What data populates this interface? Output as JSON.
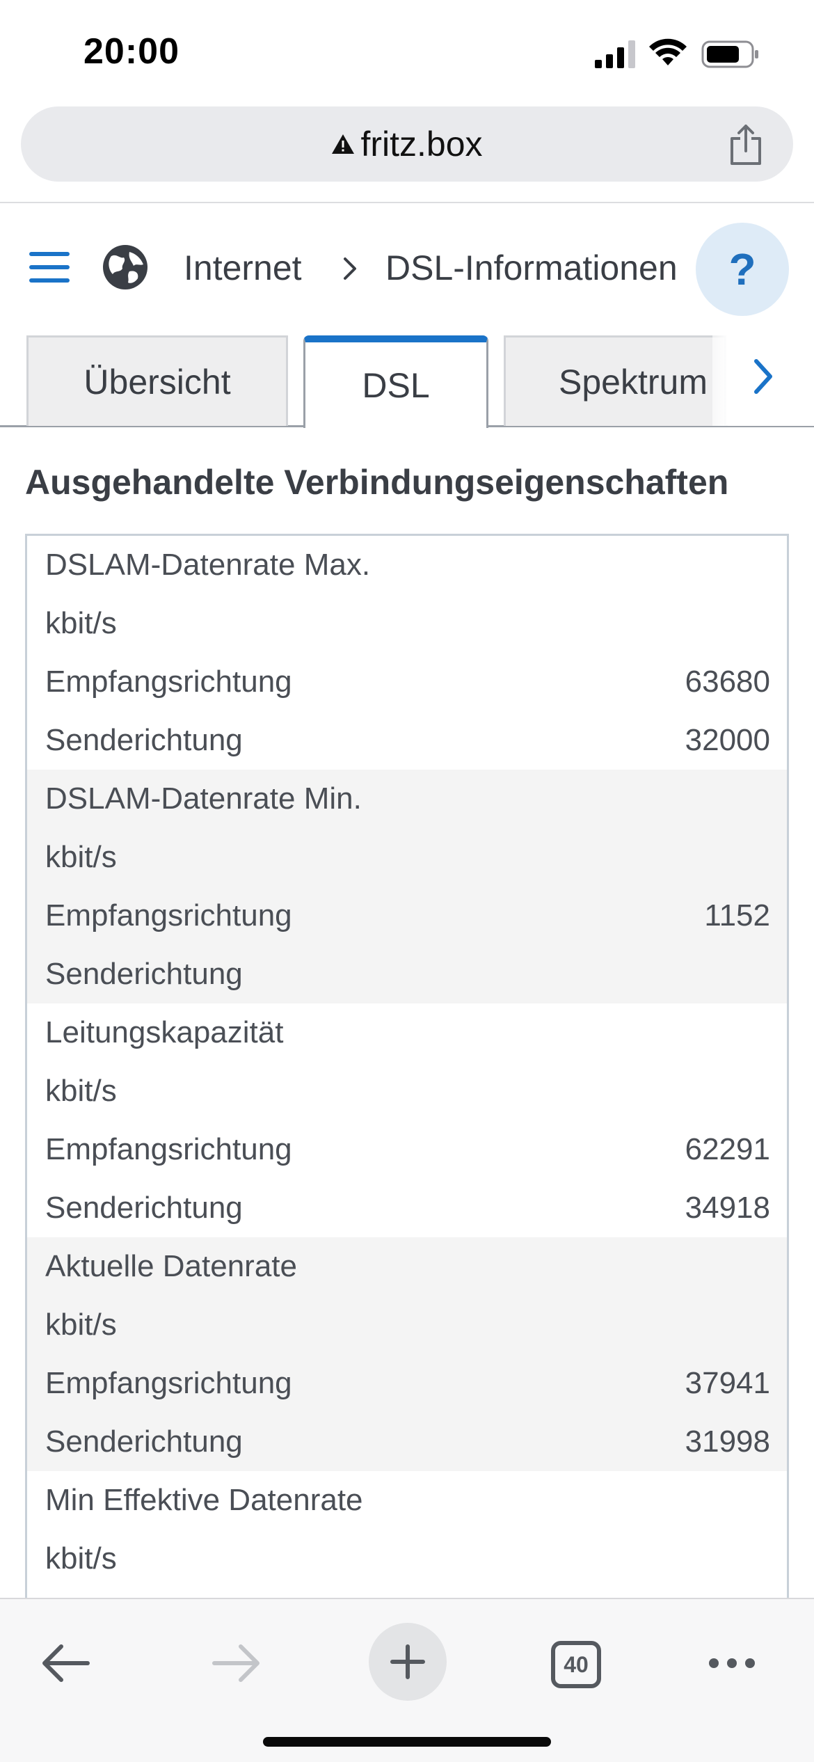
{
  "status_bar": {
    "time": "20:00",
    "icons": [
      "cellular-signal-icon",
      "wifi-icon",
      "battery-icon"
    ]
  },
  "browser": {
    "url": "fritz.box",
    "security_icon": "warning-icon",
    "share_icon": "share-icon",
    "open_tabs_count": "40"
  },
  "breadcrumb": {
    "menu_icon": "hamburger-menu-icon",
    "globe_icon": "globe-icon",
    "items": [
      "Internet",
      "DSL-Informationen"
    ],
    "help_label": "?"
  },
  "tabs": [
    {
      "label": "Übersicht",
      "active": false
    },
    {
      "label": "DSL",
      "active": true
    },
    {
      "label": "Spektrum",
      "active": false
    }
  ],
  "section": {
    "title": "Ausgehandelte Verbindungseigenschaften"
  },
  "table": {
    "groups": [
      {
        "title": "DSLAM-Datenrate Max.",
        "unit": "kbit/s",
        "rows": [
          {
            "label": "Empfangsrichtung",
            "value": "63680"
          },
          {
            "label": "Senderichtung",
            "value": "32000"
          }
        ]
      },
      {
        "title": "DSLAM-Datenrate Min.",
        "unit": "kbit/s",
        "rows": [
          {
            "label": "Empfangsrichtung",
            "value": "1152"
          },
          {
            "label": "Senderichtung",
            "value": ""
          }
        ]
      },
      {
        "title": "Leitungskapazität",
        "unit": "kbit/s",
        "rows": [
          {
            "label": "Empfangsrichtung",
            "value": "62291"
          },
          {
            "label": "Senderichtung",
            "value": "34918"
          }
        ]
      },
      {
        "title": "Aktuelle Datenrate",
        "unit": "kbit/s",
        "rows": [
          {
            "label": "Empfangsrichtung",
            "value": "37941"
          },
          {
            "label": "Senderichtung",
            "value": "31998"
          }
        ]
      },
      {
        "title": "Min Effektive Datenrate",
        "unit": "kbit/s",
        "rows": []
      }
    ]
  },
  "colors": {
    "accent": "#1a73c8",
    "help_bg": "#deebf7",
    "row_shade": "#f4f4f4"
  }
}
